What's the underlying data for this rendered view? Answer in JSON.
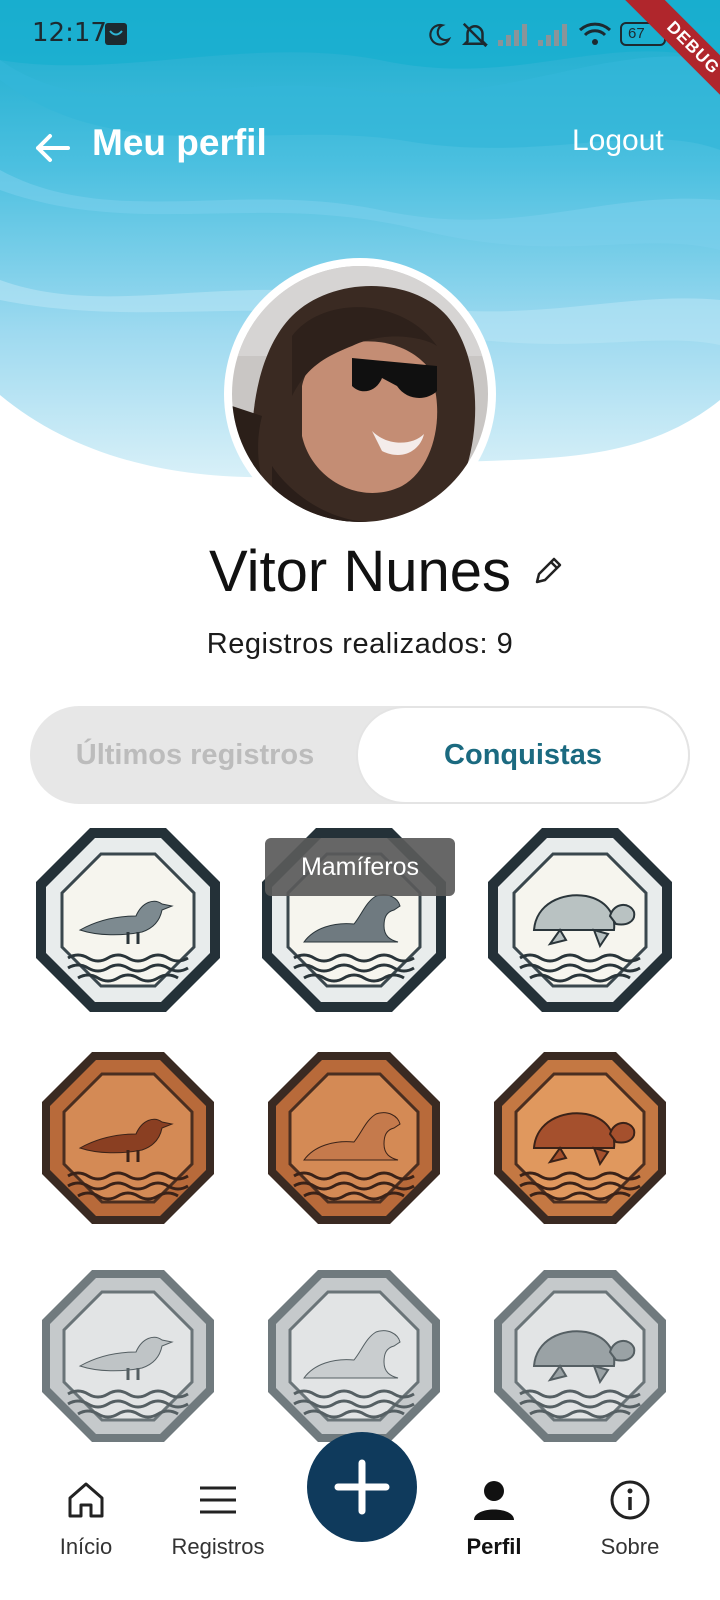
{
  "status_bar": {
    "time": "12:17",
    "battery": "67"
  },
  "debug_banner": "DEBUG",
  "app_bar": {
    "title": "Meu perfil",
    "logout_label": "Logout"
  },
  "profile": {
    "name": "Vitor Nunes",
    "records_text": "Registros realizados: 9"
  },
  "tabs": [
    {
      "label": "Últimos registros",
      "active": false
    },
    {
      "label": "Conquistas",
      "active": true
    }
  ],
  "tooltip": "Mamíferos",
  "badges": [
    {
      "animal": "bird",
      "tier": "silver-white"
    },
    {
      "animal": "seal",
      "tier": "silver-white"
    },
    {
      "animal": "turtle",
      "tier": "silver-white"
    },
    {
      "animal": "bird",
      "tier": "bronze"
    },
    {
      "animal": "seal",
      "tier": "bronze"
    },
    {
      "animal": "turtle",
      "tier": "bronze"
    },
    {
      "animal": "bird",
      "tier": "silver"
    },
    {
      "animal": "seal",
      "tier": "silver"
    },
    {
      "animal": "turtle",
      "tier": "silver"
    }
  ],
  "bottom_nav": [
    {
      "label": "Início",
      "icon": "home-icon",
      "active": false
    },
    {
      "label": "Registros",
      "icon": "menu-icon",
      "active": false
    },
    {
      "label": "Perfil",
      "icon": "person-icon",
      "active": true
    },
    {
      "label": "Sobre",
      "icon": "info-icon",
      "active": false
    }
  ],
  "fab_icon": "plus-icon",
  "colors": {
    "header_top": "#1cb0cf",
    "header_bottom": "#d2eef8",
    "accent": "#1b6a80",
    "fab": "#0f3a5c",
    "bronze": "#c87a45",
    "silver": "#c9cdcf"
  }
}
